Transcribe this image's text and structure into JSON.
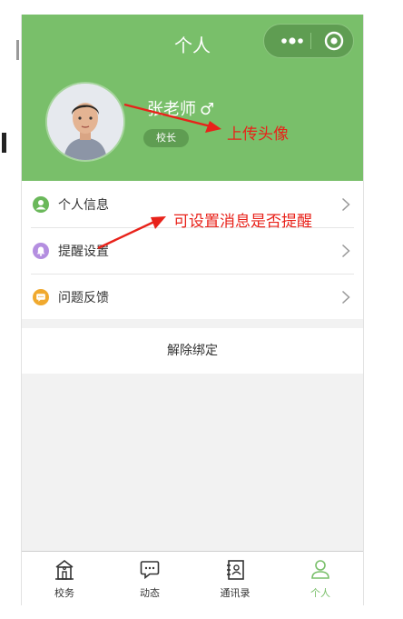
{
  "header": {
    "title": "个人"
  },
  "profile": {
    "name": "张老师",
    "gender_symbol": "♂",
    "role": "校长"
  },
  "menu": {
    "items": [
      {
        "label": "个人信息",
        "icon": "user-icon",
        "color": "#6ab85a"
      },
      {
        "label": "提醒设置",
        "icon": "bell-icon",
        "color": "#b48ee0"
      },
      {
        "label": "问题反馈",
        "icon": "chat-icon",
        "color": "#f0a92e"
      }
    ]
  },
  "unbind": {
    "label": "解除绑定"
  },
  "tabs": [
    {
      "label": "校务",
      "icon": "school-icon",
      "active": false
    },
    {
      "label": "动态",
      "icon": "message-icon",
      "active": false
    },
    {
      "label": "通讯录",
      "icon": "contacts-icon",
      "active": false
    },
    {
      "label": "个人",
      "icon": "person-icon",
      "active": true
    }
  ],
  "annotations": {
    "avatar_note": "上传头像",
    "reminder_note": "可设置消息是否提醒"
  },
  "colors": {
    "theme_green": "#79bf6a",
    "annotation_red": "#e8221a"
  }
}
